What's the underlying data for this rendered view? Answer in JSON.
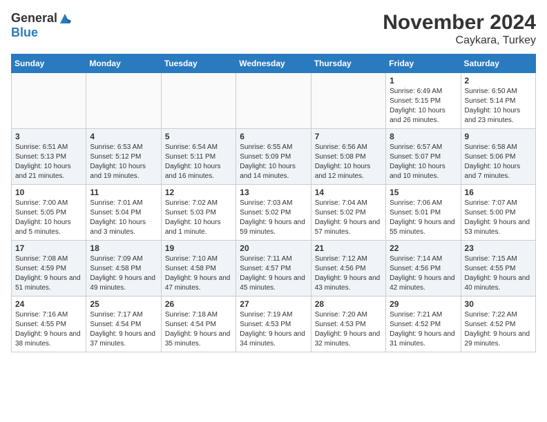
{
  "logo": {
    "general": "General",
    "blue": "Blue"
  },
  "title": "November 2024",
  "subtitle": "Caykara, Turkey",
  "weekdays": [
    "Sunday",
    "Monday",
    "Tuesday",
    "Wednesday",
    "Thursday",
    "Friday",
    "Saturday"
  ],
  "weeks": [
    [
      {
        "day": "",
        "info": ""
      },
      {
        "day": "",
        "info": ""
      },
      {
        "day": "",
        "info": ""
      },
      {
        "day": "",
        "info": ""
      },
      {
        "day": "",
        "info": ""
      },
      {
        "day": "1",
        "info": "Sunrise: 6:49 AM\nSunset: 5:15 PM\nDaylight: 10 hours and 26 minutes."
      },
      {
        "day": "2",
        "info": "Sunrise: 6:50 AM\nSunset: 5:14 PM\nDaylight: 10 hours and 23 minutes."
      }
    ],
    [
      {
        "day": "3",
        "info": "Sunrise: 6:51 AM\nSunset: 5:13 PM\nDaylight: 10 hours and 21 minutes."
      },
      {
        "day": "4",
        "info": "Sunrise: 6:53 AM\nSunset: 5:12 PM\nDaylight: 10 hours and 19 minutes."
      },
      {
        "day": "5",
        "info": "Sunrise: 6:54 AM\nSunset: 5:11 PM\nDaylight: 10 hours and 16 minutes."
      },
      {
        "day": "6",
        "info": "Sunrise: 6:55 AM\nSunset: 5:09 PM\nDaylight: 10 hours and 14 minutes."
      },
      {
        "day": "7",
        "info": "Sunrise: 6:56 AM\nSunset: 5:08 PM\nDaylight: 10 hours and 12 minutes."
      },
      {
        "day": "8",
        "info": "Sunrise: 6:57 AM\nSunset: 5:07 PM\nDaylight: 10 hours and 10 minutes."
      },
      {
        "day": "9",
        "info": "Sunrise: 6:58 AM\nSunset: 5:06 PM\nDaylight: 10 hours and 7 minutes."
      }
    ],
    [
      {
        "day": "10",
        "info": "Sunrise: 7:00 AM\nSunset: 5:05 PM\nDaylight: 10 hours and 5 minutes."
      },
      {
        "day": "11",
        "info": "Sunrise: 7:01 AM\nSunset: 5:04 PM\nDaylight: 10 hours and 3 minutes."
      },
      {
        "day": "12",
        "info": "Sunrise: 7:02 AM\nSunset: 5:03 PM\nDaylight: 10 hours and 1 minute."
      },
      {
        "day": "13",
        "info": "Sunrise: 7:03 AM\nSunset: 5:02 PM\nDaylight: 9 hours and 59 minutes."
      },
      {
        "day": "14",
        "info": "Sunrise: 7:04 AM\nSunset: 5:02 PM\nDaylight: 9 hours and 57 minutes."
      },
      {
        "day": "15",
        "info": "Sunrise: 7:06 AM\nSunset: 5:01 PM\nDaylight: 9 hours and 55 minutes."
      },
      {
        "day": "16",
        "info": "Sunrise: 7:07 AM\nSunset: 5:00 PM\nDaylight: 9 hours and 53 minutes."
      }
    ],
    [
      {
        "day": "17",
        "info": "Sunrise: 7:08 AM\nSunset: 4:59 PM\nDaylight: 9 hours and 51 minutes."
      },
      {
        "day": "18",
        "info": "Sunrise: 7:09 AM\nSunset: 4:58 PM\nDaylight: 9 hours and 49 minutes."
      },
      {
        "day": "19",
        "info": "Sunrise: 7:10 AM\nSunset: 4:58 PM\nDaylight: 9 hours and 47 minutes."
      },
      {
        "day": "20",
        "info": "Sunrise: 7:11 AM\nSunset: 4:57 PM\nDaylight: 9 hours and 45 minutes."
      },
      {
        "day": "21",
        "info": "Sunrise: 7:12 AM\nSunset: 4:56 PM\nDaylight: 9 hours and 43 minutes."
      },
      {
        "day": "22",
        "info": "Sunrise: 7:14 AM\nSunset: 4:56 PM\nDaylight: 9 hours and 42 minutes."
      },
      {
        "day": "23",
        "info": "Sunrise: 7:15 AM\nSunset: 4:55 PM\nDaylight: 9 hours and 40 minutes."
      }
    ],
    [
      {
        "day": "24",
        "info": "Sunrise: 7:16 AM\nSunset: 4:55 PM\nDaylight: 9 hours and 38 minutes."
      },
      {
        "day": "25",
        "info": "Sunrise: 7:17 AM\nSunset: 4:54 PM\nDaylight: 9 hours and 37 minutes."
      },
      {
        "day": "26",
        "info": "Sunrise: 7:18 AM\nSunset: 4:54 PM\nDaylight: 9 hours and 35 minutes."
      },
      {
        "day": "27",
        "info": "Sunrise: 7:19 AM\nSunset: 4:53 PM\nDaylight: 9 hours and 34 minutes."
      },
      {
        "day": "28",
        "info": "Sunrise: 7:20 AM\nSunset: 4:53 PM\nDaylight: 9 hours and 32 minutes."
      },
      {
        "day": "29",
        "info": "Sunrise: 7:21 AM\nSunset: 4:52 PM\nDaylight: 9 hours and 31 minutes."
      },
      {
        "day": "30",
        "info": "Sunrise: 7:22 AM\nSunset: 4:52 PM\nDaylight: 9 hours and 29 minutes."
      }
    ]
  ]
}
